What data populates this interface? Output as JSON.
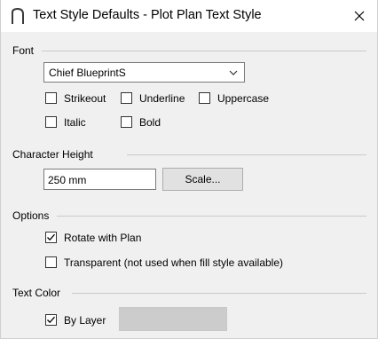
{
  "window": {
    "title": "Text Style Defaults - Plot Plan Text Style"
  },
  "font": {
    "section_label": "Font",
    "font_name": "Chief BlueprintS",
    "strikeout_label": "Strikeout",
    "strikeout_checked": false,
    "underline_label": "Underline",
    "underline_checked": false,
    "uppercase_label": "Uppercase",
    "uppercase_checked": false,
    "italic_label": "Italic",
    "italic_checked": false,
    "bold_label": "Bold",
    "bold_checked": false
  },
  "character_height": {
    "section_label": "Character Height",
    "value": "250 mm",
    "scale_button_label": "Scale..."
  },
  "options": {
    "section_label": "Options",
    "rotate_label": "Rotate with Plan",
    "rotate_checked": true,
    "transparent_label": "Transparent (not used when fill style available)",
    "transparent_checked": false
  },
  "text_color": {
    "section_label": "Text Color",
    "by_layer_label": "By Layer",
    "by_layer_checked": true,
    "swatch_color": "#cccccc"
  },
  "icons": {
    "app": "chief-architect-icon",
    "close": "close-icon",
    "dropdown": "chevron-down-icon",
    "check": "check-icon"
  }
}
